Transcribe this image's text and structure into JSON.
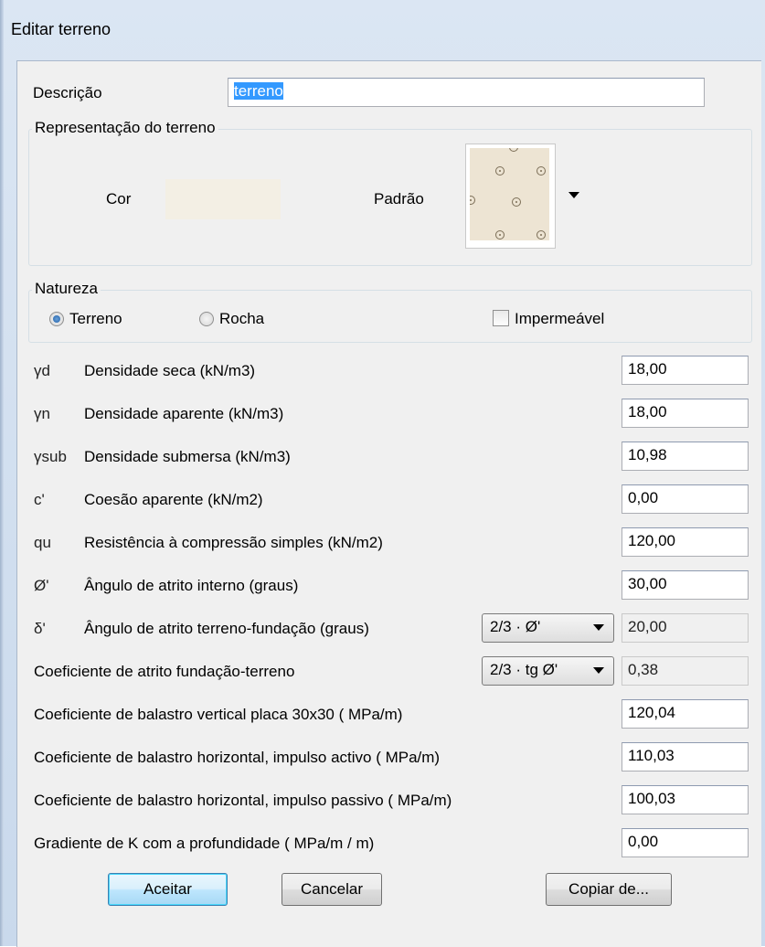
{
  "window": {
    "title": "Editar terreno"
  },
  "descricao": {
    "label": "Descrição",
    "value": "terreno"
  },
  "representacao": {
    "legend": "Representação do terreno",
    "cor_label": "Cor",
    "cor_color": "#f3efe4",
    "padrao_label": "Padrão",
    "pattern_color": "#ede4d3"
  },
  "natureza": {
    "legend": "Natureza",
    "terreno_label": "Terreno",
    "rocha_label": "Rocha",
    "impermeavel_label": "Impermeável",
    "selected": "Terreno",
    "impermeavel_checked": false
  },
  "rows": [
    {
      "symbol": "γd",
      "label": "Densidade seca (kN/m3)",
      "value": "18,00"
    },
    {
      "symbol": "γn",
      "label": "Densidade aparente (kN/m3)",
      "value": "18,00"
    },
    {
      "symbol": "γsub",
      "label": "Densidade submersa (kN/m3)",
      "value": "10,98"
    },
    {
      "symbol": "c'",
      "label": "Coesão aparente (kN/m2)",
      "value": "0,00"
    },
    {
      "symbol": "qu",
      "label": "Resistência à compressão simples (kN/m2)",
      "value": "120,00"
    },
    {
      "symbol": "Ø'",
      "label": "Ângulo de atrito interno (graus)",
      "value": "30,00"
    },
    {
      "symbol": "δ'",
      "label": "Ângulo de atrito terreno-fundação (graus)",
      "combo": "2/3 · Ø'",
      "value": "20,00"
    },
    {
      "label": "Coeficiente de atrito fundação-terreno",
      "combo": "2/3 · tg Ø'",
      "value": "0,38"
    },
    {
      "label": "Coeficiente de balastro vertical placa 30x30 ( MPa/m)",
      "value": "120,04"
    },
    {
      "label": "Coeficiente de balastro horizontal, impulso activo ( MPa/m)",
      "value": "110,03"
    },
    {
      "label": "Coeficiente de balastro horizontal, impulso passivo ( MPa/m)",
      "value": "100,03"
    },
    {
      "label": "Gradiente de K com a profundidade ( MPa/m / m)",
      "value": "0,00"
    }
  ],
  "buttons": {
    "accept": "Aceitar",
    "cancel": "Cancelar",
    "copy": "Copiar de..."
  }
}
